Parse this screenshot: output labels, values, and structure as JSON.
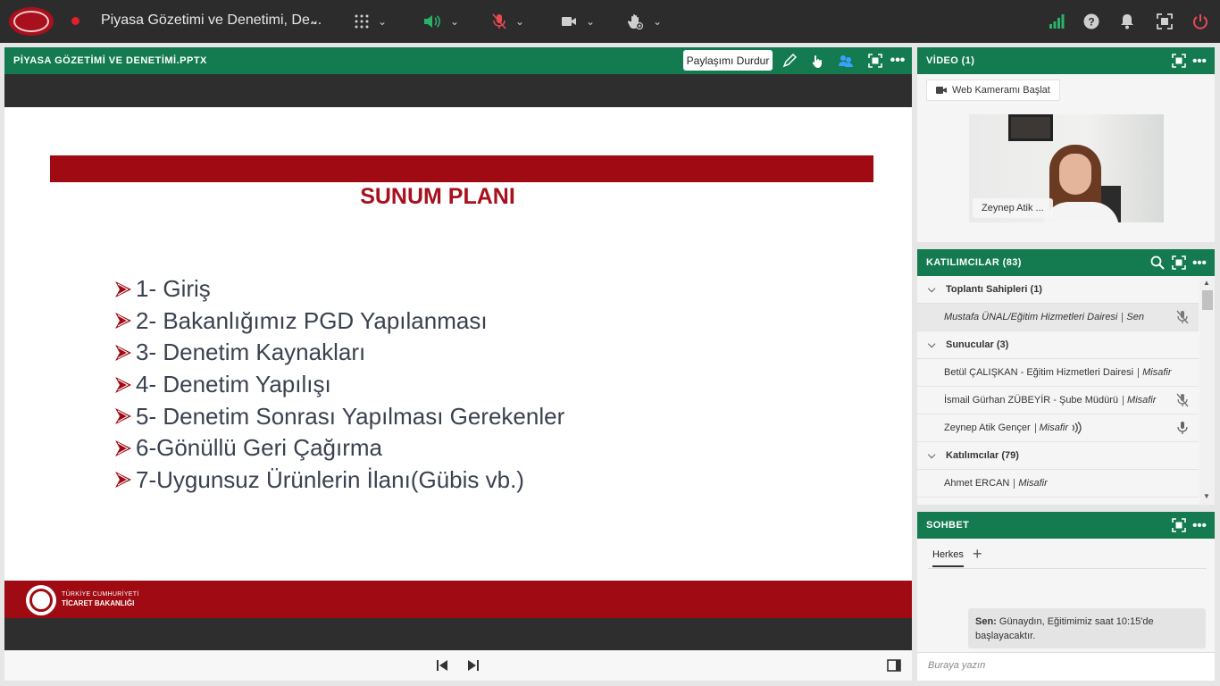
{
  "topbar": {
    "meeting_title": "Piyasa Gözetimi ve Denetimi, De...",
    "colors": {
      "bg": "#2c2c2c",
      "audio": "#28b36b",
      "mic_off": "#e64a53",
      "signal": "#28b36b",
      "power": "#e64a53"
    },
    "icons": [
      "apps-grid-icon",
      "speaker-icon",
      "mic-muted-icon",
      "camera-icon",
      "raise-hand-icon",
      "signal-icon",
      "help-icon",
      "notifications-icon",
      "fullscreen-icon",
      "power-icon"
    ]
  },
  "share_pod": {
    "title": "PİYASA GÖZETİMİ VE DENETİMİ.PPTX",
    "stop_label": "Paylaşımı Durdur",
    "slide": {
      "heading": "SUNUM PLANI",
      "items": [
        "1- Giriş",
        "2- Bakanlığımız PGD Yapılanması",
        "3- Denetim Kaynakları",
        "4- Denetim Yapılışı",
        "5- Denetim Sonrası Yapılması Gerekenler",
        "6-Gönüllü Geri Çağırma",
        "7-Uygunsuz Ürünlerin İlanı(Gübis vb.)"
      ],
      "footer_line1": "TÜRKİYE CUMHURİYETİ",
      "footer_line2": "TİCARET BAKANLIĞI"
    }
  },
  "video_pod": {
    "title": "VİDEO (1)",
    "webcam_label": "Web Kameramı Başlat",
    "name_tag": "Zeynep Atik ..."
  },
  "participants_pod": {
    "title": "KATILIMCILAR  (83)",
    "sections": {
      "hosts": "Toplantı Sahipleri (1)",
      "presenters": "Sunucular (3)",
      "attendees": "Katılımcılar (79)"
    },
    "rows": [
      {
        "name": "Mustafa ÜNAL/Eğitim Hizmetleri Dairesi",
        "role": "Sen"
      },
      {
        "name": "Betül ÇALIŞKAN - Eğitim Hizmetleri Dairesi",
        "role": "Misafir"
      },
      {
        "name": "İsmail Gürhan ZÜBEYİR - Şube Müdürü",
        "role": "Misafir"
      },
      {
        "name": "Zeynep Atik Gençer",
        "role": "Misafir"
      },
      {
        "name": "Ahmet ERCAN",
        "role": "Misafir"
      }
    ]
  },
  "chat_pod": {
    "title": "SOHBET",
    "tab": "Herkes",
    "message_sender": "Sen:",
    "message_text": "Günaydın, Eğitimimiz saat 10:15'de başlayacaktır.",
    "input_placeholder": "Buraya yazın"
  }
}
